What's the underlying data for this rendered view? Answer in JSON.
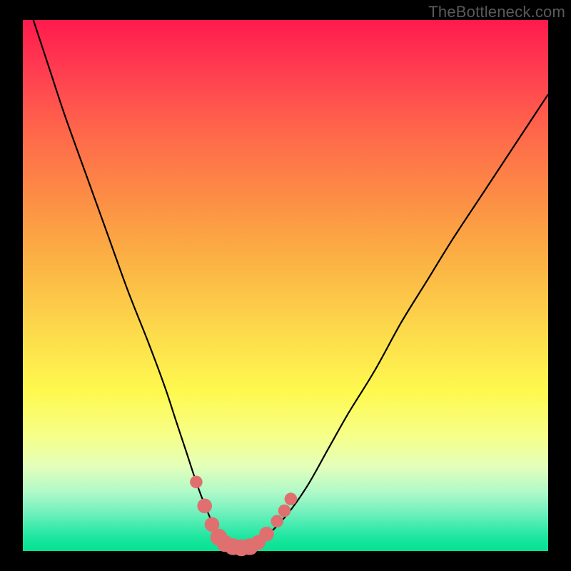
{
  "watermark": {
    "text": "TheBottleneck.com"
  },
  "colors": {
    "frame": "#000000",
    "curve_stroke": "#000000",
    "beads_fill": "#e07070",
    "beads_stroke": "#b85555"
  },
  "chart_data": {
    "type": "line",
    "title": "",
    "xlabel": "",
    "ylabel": "",
    "xlim": [
      0,
      100
    ],
    "ylim": [
      0,
      100
    ],
    "grid": false,
    "legend": false,
    "note": "Axes unlabeled in source image; values are percent-of-plot coordinates estimated from pixels (y=0 at bottom, y=100 at top).",
    "series": [
      {
        "name": "curve",
        "x": [
          2,
          5,
          8,
          12,
          16,
          20,
          24,
          27,
          29,
          31,
          33,
          34.5,
          36,
          37.5,
          39,
          41,
          43,
          46,
          50,
          54,
          58,
          62,
          67,
          72,
          77,
          82,
          88,
          94,
          100
        ],
        "y": [
          100,
          91,
          82,
          71,
          60,
          49,
          39,
          31,
          25,
          19,
          13,
          9,
          5.5,
          3,
          1.5,
          0.6,
          0.6,
          2.5,
          6.5,
          12,
          19,
          26,
          34,
          43,
          51,
          59,
          68,
          77,
          86
        ]
      }
    ],
    "beads": {
      "name": "beads",
      "points": [
        {
          "x": 33.0,
          "y": 13.0,
          "r": 1.2
        },
        {
          "x": 34.6,
          "y": 8.5,
          "r": 1.4
        },
        {
          "x": 36.0,
          "y": 5.0,
          "r": 1.4
        },
        {
          "x": 37.3,
          "y": 2.6,
          "r": 1.6
        },
        {
          "x": 38.5,
          "y": 1.4,
          "r": 1.6
        },
        {
          "x": 40.0,
          "y": 0.8,
          "r": 1.6
        },
        {
          "x": 41.6,
          "y": 0.6,
          "r": 1.6
        },
        {
          "x": 43.2,
          "y": 0.8,
          "r": 1.6
        },
        {
          "x": 44.8,
          "y": 1.6,
          "r": 1.4
        },
        {
          "x": 46.4,
          "y": 3.2,
          "r": 1.4
        },
        {
          "x": 48.4,
          "y": 5.6,
          "r": 1.2
        },
        {
          "x": 49.8,
          "y": 7.6,
          "r": 1.2
        },
        {
          "x": 51.0,
          "y": 9.8,
          "r": 1.2
        }
      ]
    }
  }
}
